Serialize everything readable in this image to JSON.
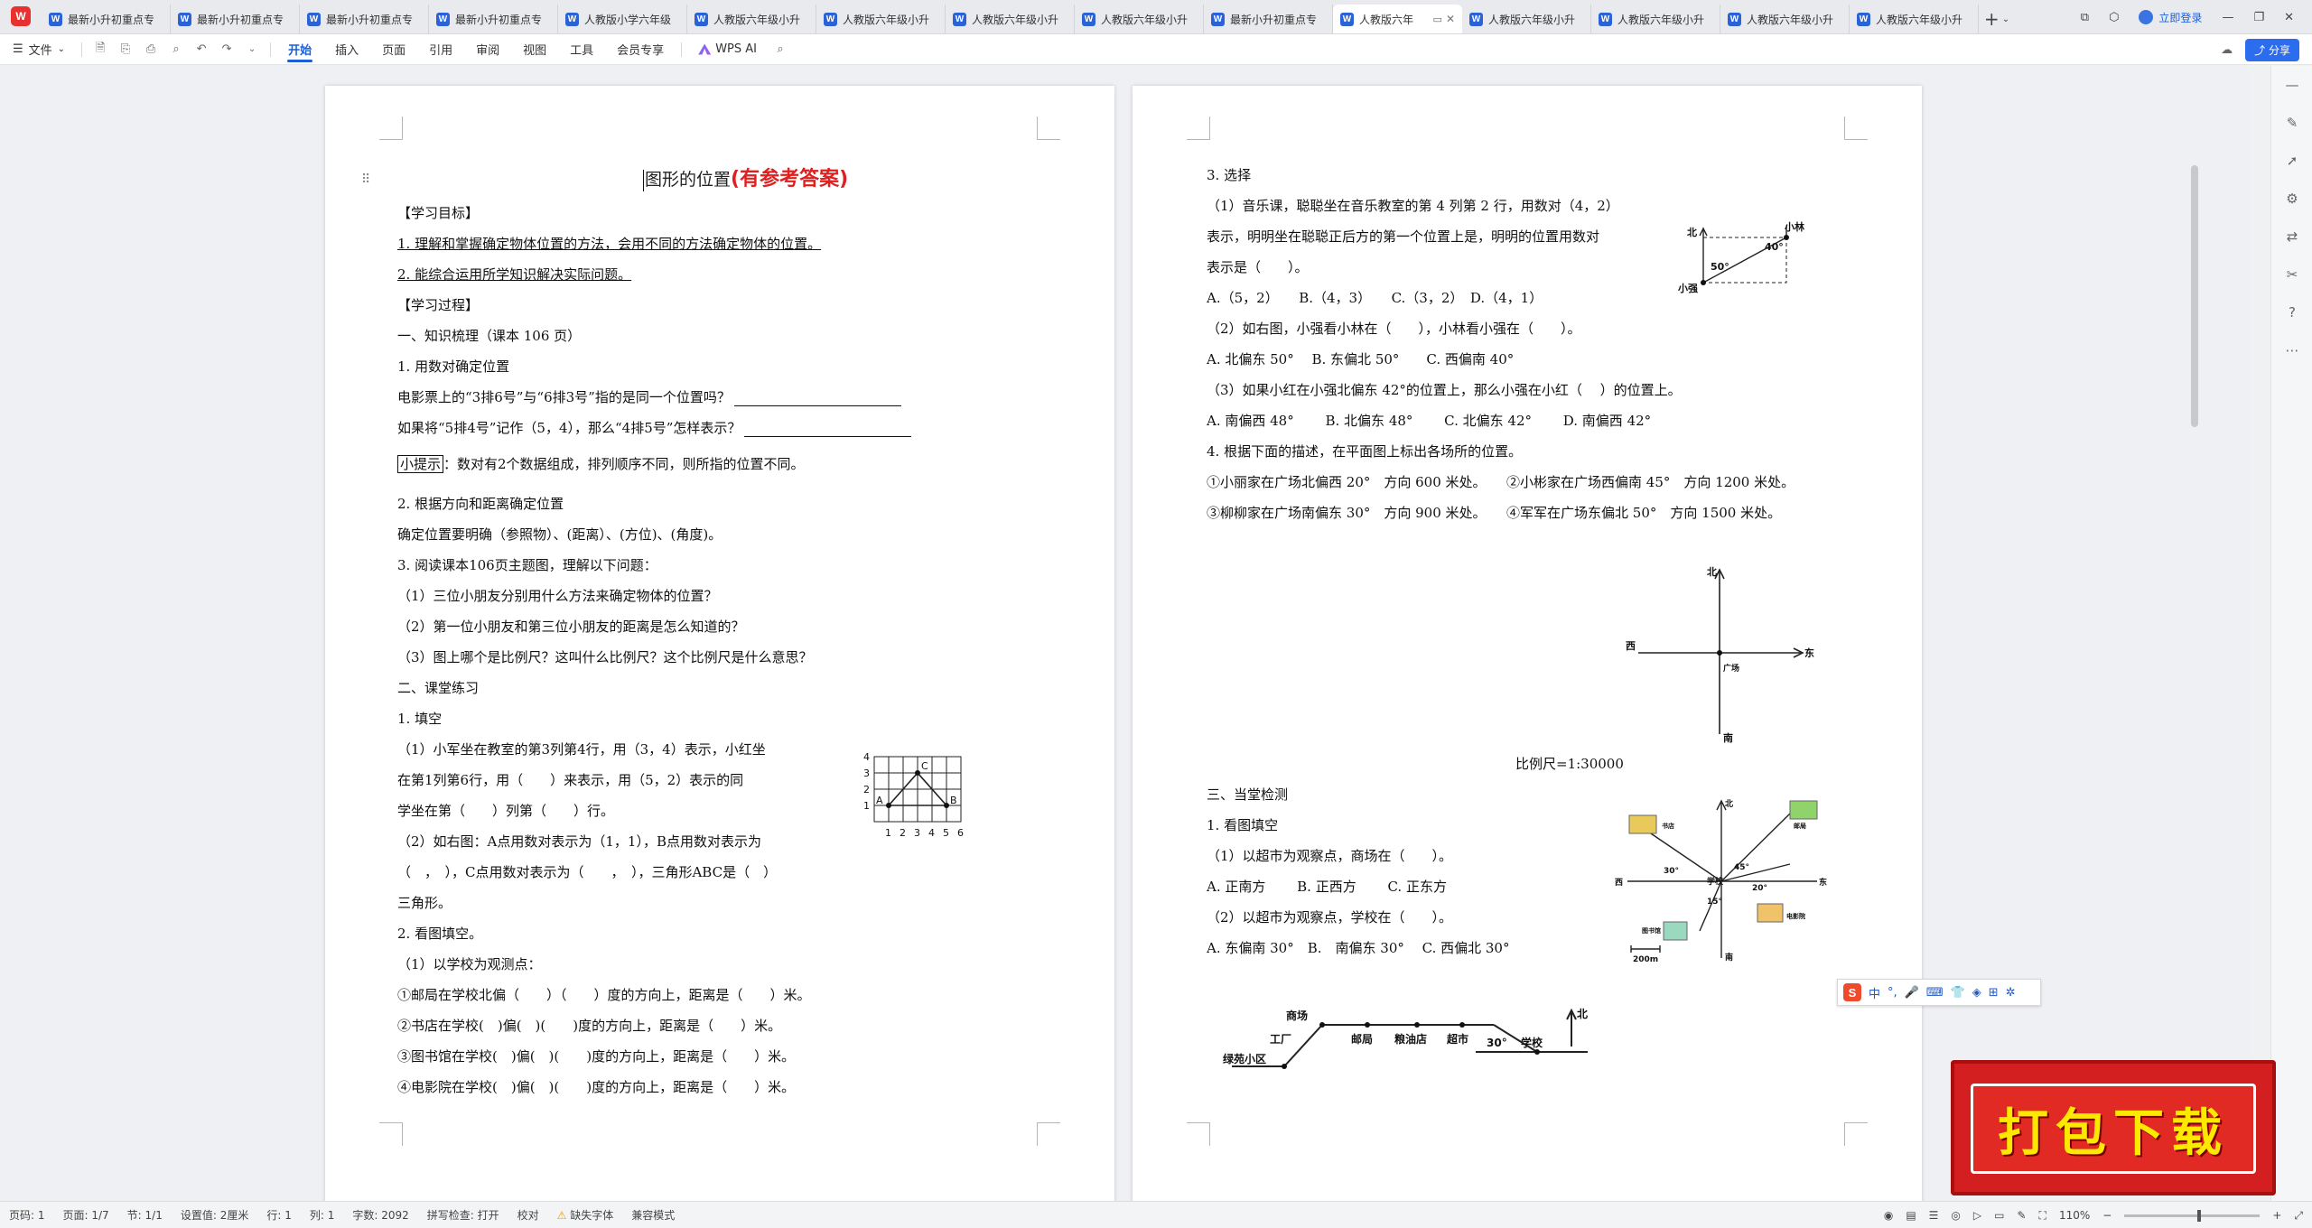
{
  "tabs": [
    {
      "label": "最新小升初重点专"
    },
    {
      "label": "最新小升初重点专"
    },
    {
      "label": "最新小升初重点专"
    },
    {
      "label": "最新小升初重点专"
    },
    {
      "label": "人教版小学六年级"
    },
    {
      "label": "人教版六年级小升"
    },
    {
      "label": "人教版六年级小升"
    },
    {
      "label": "人教版六年级小升"
    },
    {
      "label": "人教版六年级小升"
    },
    {
      "label": "最新小升初重点专"
    },
    {
      "label": "人教版六年"
    },
    {
      "label": "人教版六年级小升"
    },
    {
      "label": "人教版六年级小升"
    },
    {
      "label": "人教版六年级小升"
    },
    {
      "label": "人教版六年级小升"
    }
  ],
  "titlebar": {
    "login": "立即登录"
  },
  "menu": {
    "file": "文件",
    "items": [
      "开始",
      "插入",
      "页面",
      "引用",
      "审阅",
      "视图",
      "工具",
      "会员专享"
    ],
    "active": "开始",
    "ai": "WPS AI",
    "share": "分享"
  },
  "left_page": {
    "title_main": "图形的位置",
    "title_red": "(有参考答案)",
    "lines": [
      "【学习目标】",
      "1. 理解和掌握确定物体位置的方法，会用不同的方法确定物体的位置。",
      "2. 能综合运用所学知识解决实际问题。",
      "【学习过程】",
      "一、知识梳理（课本 106 页）",
      "1. 用数对确定位置",
      "电影票上的“3排6号”与“6排3号”指的是同一个位置吗？",
      "如果将“5排4号”记作（5，4），那么“4排5号”怎样表示？",
      "小提示",
      "：数对有2个数据组成，排列顺序不同，则所指的位置不同。",
      "2. 根据方向和距离确定位置",
      "确定位置要明确（参照物）、(距离）、(方位)、(角度)。",
      "3. 阅读课本106页主题图，理解以下问题：",
      "（1）三位小朋友分别用什么方法来确定物体的位置？",
      "（2）第一位小朋友和第三位小朋友的距离是怎么知道的？",
      "（3）图上哪个是比例尺？这叫什么比例尺？这个比例尺是什么意思？",
      "二、课堂练习",
      "1. 填空",
      "（1）小军坐在教室的第3列第4行，用（3，4）表示，小红坐",
      "在第1列第6行，用（　　）来表示，用（5，2）表示的同",
      "学坐在第（　　）列第（　　）行。",
      "（2）如右图：A点用数对表示为（1，1），B点用数对表示为",
      "（　，　），C点用数对表示为（　　，　），三角形ABC是（　）",
      "三角形。",
      "2. 看图填空。",
      "（1）以学校为观测点：",
      "①邮局在学校北偏（　　）（　　）度的方向上，距离是（　　）米。",
      "②书店在学校(　)偏(　)(　　)度的方向上，距离是（　　）米。",
      "③图书馆在学校(　)偏(　)(　　)度的方向上，距离是（　　）米。",
      "④电影院在学校(　)偏(　)(　　)度的方向上，距离是（　　）米。"
    ],
    "grid_fig": {
      "x_ticks": [
        "1",
        "2",
        "3",
        "4",
        "5",
        "6"
      ],
      "y_ticks": [
        "1",
        "2",
        "3",
        "4"
      ],
      "points": [
        "A",
        "B",
        "C"
      ]
    }
  },
  "right_page": {
    "lines": [
      "3. 选择",
      "（1）音乐课，聪聪坐在音乐教室的第 4 列第 2 行，用数对（4，2）",
      "表示，明明坐在聪聪正后方的第一个位置上是，明明的位置用数对",
      "表示是（　　）。",
      "A.（5，2）　　B.（4，3）　　C.（3，2）　D.（4，1）",
      "（2）如右图，小强看小林在（　　），小林看小强在（　　）。",
      "A. 北偏东 50°　 B. 东偏北 50°　　C. 西偏南 40°",
      "（3）如果小红在小强北偏东 42°的位置上，那么小强在小红（　 ）的位置上。",
      "A. 南偏西 48°　　 B. 北偏东 48°　　 C. 北偏东 42°　　 D. 南偏西 42°",
      "4. 根据下面的描述，在平面图上标出各场所的位置。",
      "①小丽家在广场北偏西 20°　方向 600 米处。　　②小彬家在广场西偏南 45°　方向 1200 米处。",
      "③柳柳家在广场南偏东 30°　方向 900 米处。　　④军军在广场东偏北 50°　方向 1500 米处。",
      "比例尺=1:30000",
      "三、当堂检测",
      "1. 看图填空",
      "（1）以超市为观察点，商场在（　　）。",
      "A. 正南方　　 B. 正西方　　 C. 正东方",
      "（2）以超市为观察点，学校在（　　）。",
      "A. 东偏南 30°　B.　南偏东 30°　 C. 西偏北 30°"
    ],
    "fig_angle": {
      "north": "北",
      "p1": "小林",
      "p2": "小强",
      "a1": "40°",
      "a2": "50°"
    },
    "fig_plaza": {
      "north": "北",
      "south": "南",
      "west": "西",
      "east": "东",
      "center": "广场"
    },
    "fig_school": {
      "north": "北",
      "south": "南",
      "west": "西",
      "east": "东",
      "center": "学校",
      "a1": "30°",
      "a2": "45°",
      "a3": "20°",
      "a4": "15°",
      "shop1": "书店",
      "shop2": "邮局",
      "shop3": "图书馆",
      "shop4": "电影院",
      "scale": "200m"
    },
    "fig_route": {
      "north": "北",
      "places": [
        "商场",
        "工厂",
        "邮局",
        "粮油店",
        "超市",
        "学校",
        "绿苑小区"
      ],
      "angle": "30°"
    }
  },
  "statusbar": {
    "page_no": "页码: 1",
    "pages": "页面: 1/7",
    "section": "节: 1/1",
    "setting": "设置值: 2厘米",
    "row": "行: 1",
    "col": "列: 1",
    "words": "字数: 2092",
    "spell": "拼写检查: 打开",
    "proof": "校对",
    "missing_font": "缺失字体",
    "compat": "兼容模式",
    "zoom": "110%"
  },
  "ime": {
    "mode": "中"
  },
  "banner": {
    "text": "打包下载"
  }
}
